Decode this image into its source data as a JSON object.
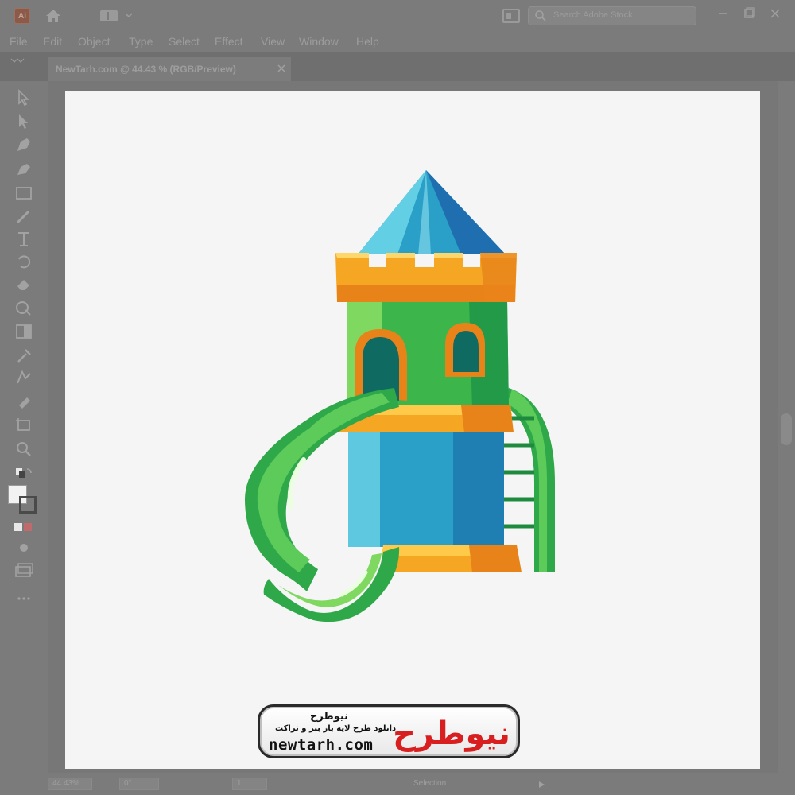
{
  "window": {
    "app_logo": "Ai",
    "search_placeholder": "Search Adobe Stock"
  },
  "menu": [
    "File",
    "Edit",
    "Object",
    "Type",
    "Select",
    "Effect",
    "View",
    "Window",
    "Help"
  ],
  "document_tab": {
    "label": "NewTarh.com @ 44.43 % (RGB/Preview)",
    "close_icon": "close-icon"
  },
  "toolbar_icons": [
    "selection-icon",
    "direct-selection-icon",
    "pen-icon",
    "curvature-icon",
    "rectangle-icon",
    "paintbrush-icon",
    "type-icon",
    "rotate-icon",
    "eraser-icon",
    "shape-builder-icon",
    "gradient-icon",
    "eyedropper-icon",
    "blend-icon",
    "symbol-sprayer-icon",
    "artboard-icon",
    "zoom-icon"
  ],
  "watermark": {
    "fa_title": "نیوطرح",
    "fa_subtitle": "دانلود طرح لایه باز بنر و تراکت",
    "url": "newtarh.com",
    "logo_text": "نیوطرح"
  },
  "status": {
    "zoom": "44.43%",
    "rotation": "0°",
    "artboard": "1",
    "mode": "Selection"
  },
  "colors": {
    "tower_green": "#3cb54a",
    "tower_blue": "#2a9fc7",
    "roof_blue": "#2b8fc4",
    "crown_orange": "#f5a623",
    "slide_green": "#4cc24a",
    "watermark_red": "#d81e1e"
  }
}
